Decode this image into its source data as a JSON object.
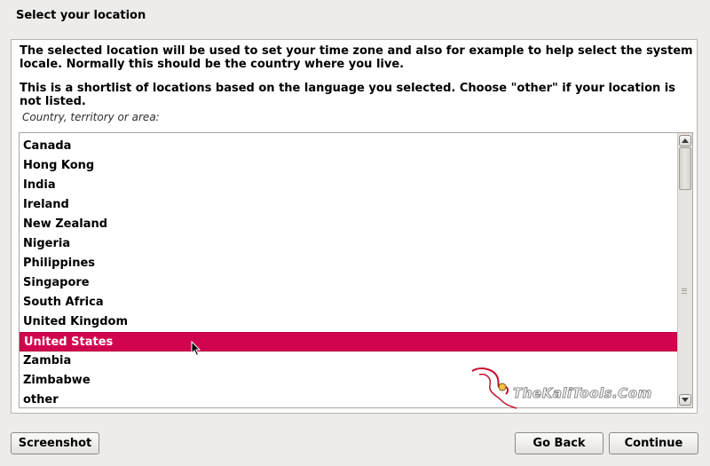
{
  "page": {
    "title": "Select your location"
  },
  "description": {
    "paragraph1": "The selected location will be used to set your time zone and also for example to help select the system locale. Normally this should be the country where you live.",
    "paragraph2": "This is a shortlist of locations based on the language you selected. Choose \"other\" if your location is not listed."
  },
  "location_field": {
    "label": "Country, territory or area:",
    "selected": "United States",
    "items": [
      "Canada",
      "Hong Kong",
      "India",
      "Ireland",
      "New Zealand",
      "Nigeria",
      "Philippines",
      "Singapore",
      "South Africa",
      "United Kingdom",
      "United States",
      "Zambia",
      "Zimbabwe",
      "other"
    ]
  },
  "watermark": {
    "text": "TheKaliTools.Com"
  },
  "buttons": {
    "screenshot": "Screenshot",
    "go_back": "Go Back",
    "continue": "Continue"
  },
  "colors": {
    "selection": "#d1054f",
    "background": "#edeceb",
    "watermark_accent": "#c8102e"
  }
}
